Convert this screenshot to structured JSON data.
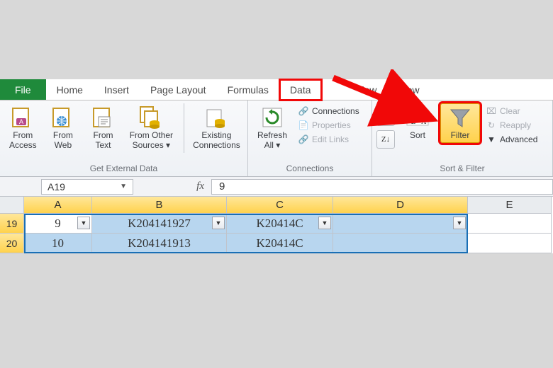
{
  "tabs": {
    "file": "File",
    "home": "Home",
    "insert": "Insert",
    "pageLayout": "Page Layout",
    "formulas": "Formulas",
    "data": "Data",
    "review": "iew",
    "view": "View"
  },
  "ribbon": {
    "getExternal": {
      "label": "Get External Data",
      "fromAccess": "From\nAccess",
      "fromWeb": "From\nWeb",
      "fromText": "From\nText",
      "fromOther": "From Other\nSources ▾",
      "existing": "Existing\nConnections"
    },
    "connections": {
      "label": "Connections",
      "refresh": "Refresh\nAll ▾",
      "connections": "Connections",
      "properties": "Properties",
      "editLinks": "Edit Links"
    },
    "sortFilter": {
      "label": "Sort & Filter",
      "sort": "Sort",
      "filter": "Filter",
      "clear": "Clear",
      "reapply": "Reapply",
      "advanced": "Advanced",
      "az": "A↓Z",
      "za": "Z↓A"
    }
  },
  "formulaBar": {
    "nameBox": "A19",
    "fx": "fx",
    "formula": "9"
  },
  "grid": {
    "columns": [
      "A",
      "B",
      "C",
      "D",
      "E"
    ],
    "rows": [
      {
        "num": "19",
        "cells": [
          "9",
          "K204141927",
          "K20414C",
          ""
        ],
        "filters": [
          true,
          true,
          true,
          true
        ]
      },
      {
        "num": "20",
        "cells": [
          "10",
          "K204141913",
          "K20414C",
          ""
        ],
        "filters": [
          false,
          false,
          false,
          false
        ]
      }
    ]
  }
}
